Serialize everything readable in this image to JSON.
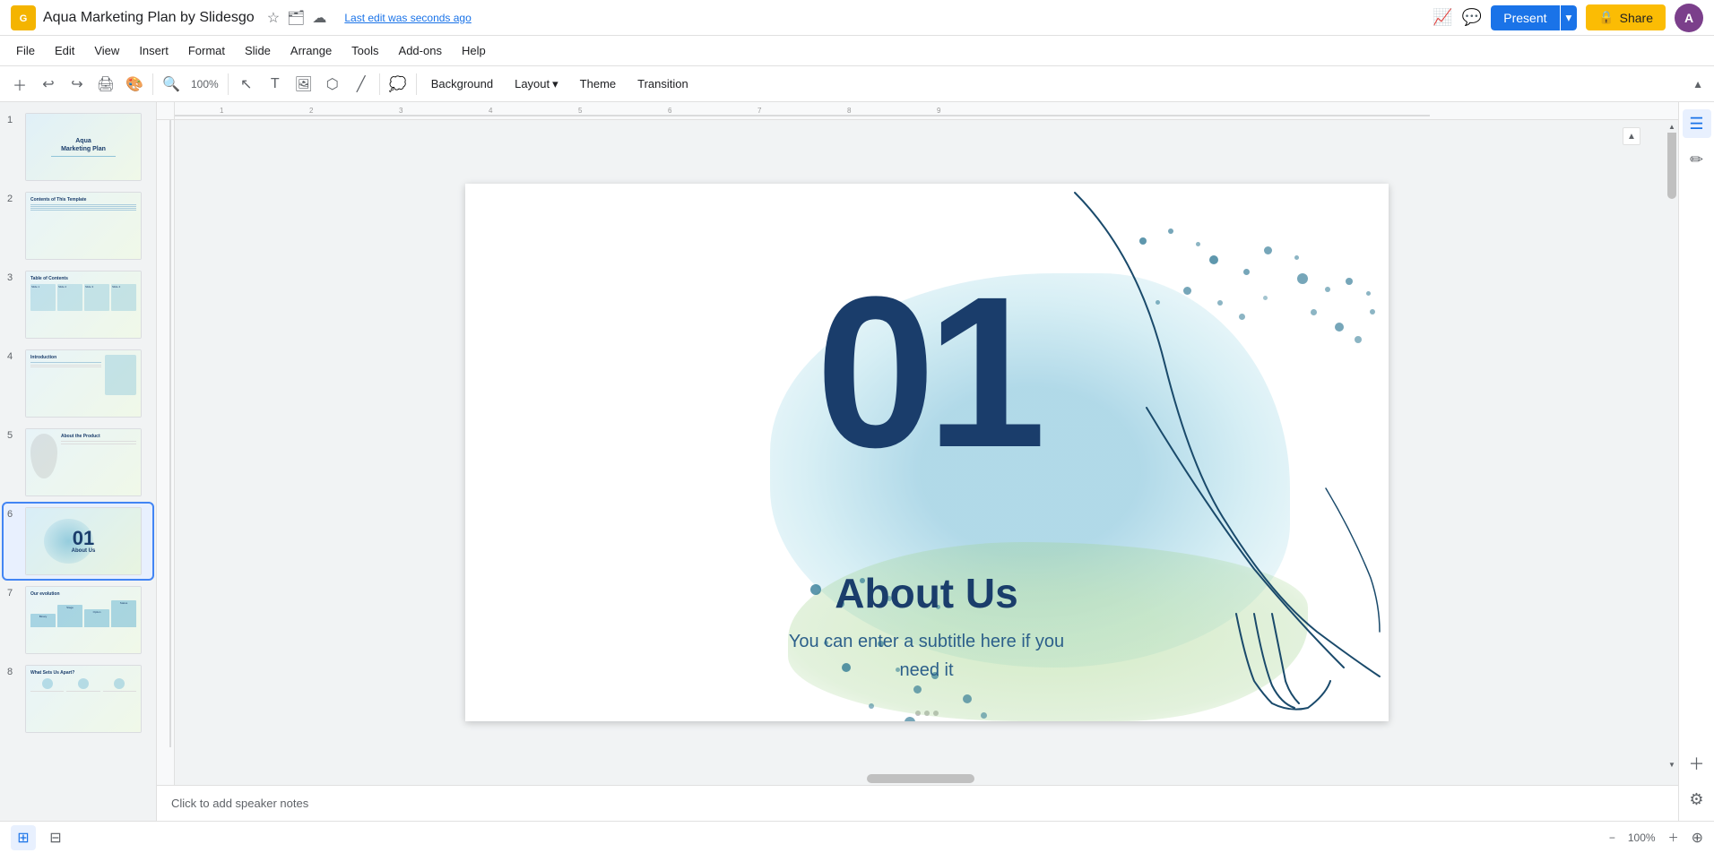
{
  "titleBar": {
    "appLogo": "G",
    "docTitle": "Aqua Marketing Plan by Slidesgo",
    "lastEdit": "Last edit was seconds ago",
    "presentLabel": "Present",
    "shareLabel": "Share",
    "shareIcon": "🔒",
    "avatarInitial": "A"
  },
  "menuBar": {
    "items": [
      "File",
      "Edit",
      "View",
      "Insert",
      "Format",
      "Slide",
      "Arrange",
      "Tools",
      "Add-ons",
      "Help"
    ]
  },
  "toolbar": {
    "backgroundLabel": "Background",
    "layoutLabel": "Layout",
    "themeLabel": "Theme",
    "transitionLabel": "Transition"
  },
  "slidePanel": {
    "slides": [
      {
        "num": "1",
        "title": "Aqua Marketing Plan"
      },
      {
        "num": "2",
        "title": "Contents of This Template"
      },
      {
        "num": "3",
        "title": "Table of Contents"
      },
      {
        "num": "4",
        "title": "Introduction"
      },
      {
        "num": "5",
        "title": "About the Product"
      },
      {
        "num": "6",
        "title": "01 About Us",
        "active": true
      },
      {
        "num": "7",
        "title": "Our evolution"
      },
      {
        "num": "8",
        "title": "What Sets Us Apart?"
      }
    ]
  },
  "mainSlide": {
    "number": "01",
    "heading": "About Us",
    "subtitle": "You can enter a subtitle here if you\nneed it"
  },
  "notesBar": {
    "placeholder": "Click to add speaker notes"
  },
  "bottomBar": {
    "viewGrid": "⊞",
    "viewFilm": "⊟"
  }
}
